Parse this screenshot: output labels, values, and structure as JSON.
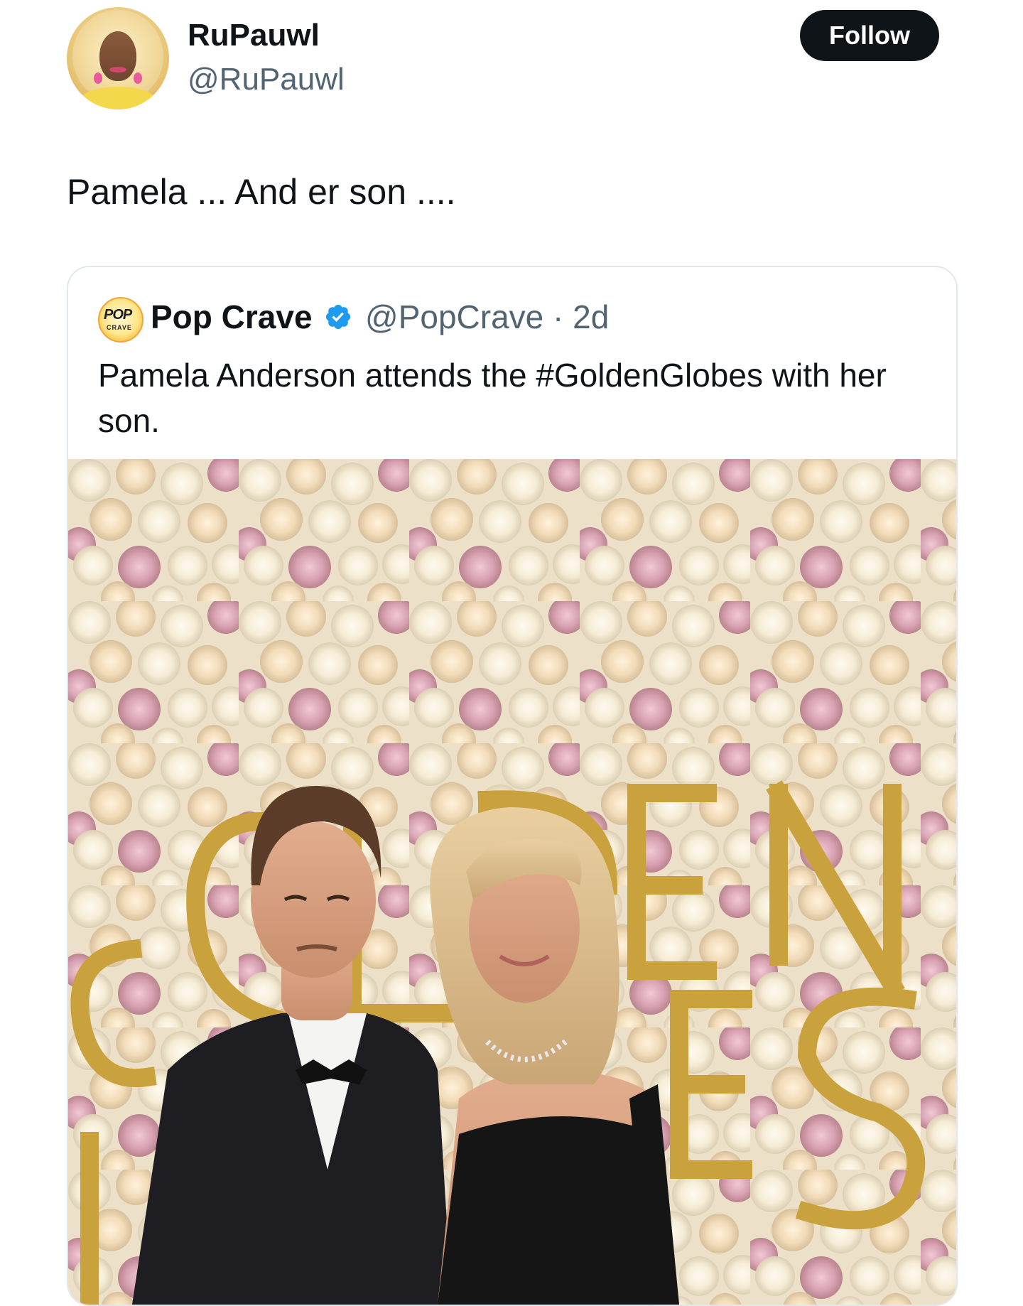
{
  "author": {
    "display_name": "RuPauwl",
    "handle": "@RuPauwl",
    "avatar_icon": "profile-photo"
  },
  "follow_button": {
    "label": "Follow"
  },
  "tweet_text": "Pamela ... And er son ....",
  "quoted_tweet": {
    "display_name": "Pop Crave",
    "avatar_text_top": "POP",
    "avatar_text_bottom": "CRAVE",
    "verified_icon": "verified-badge-icon",
    "handle_time": "@PopCrave · 2d",
    "text": "Pamela Anderson attends the #GoldenGlobes with her son.",
    "media_description_icon": "photo"
  },
  "colors": {
    "primary_text": "#0f1419",
    "secondary_text": "#536471",
    "follow_bg": "#0f1419",
    "verified_blue": "#1d9bf0",
    "card_border": "#e1e8ed"
  }
}
